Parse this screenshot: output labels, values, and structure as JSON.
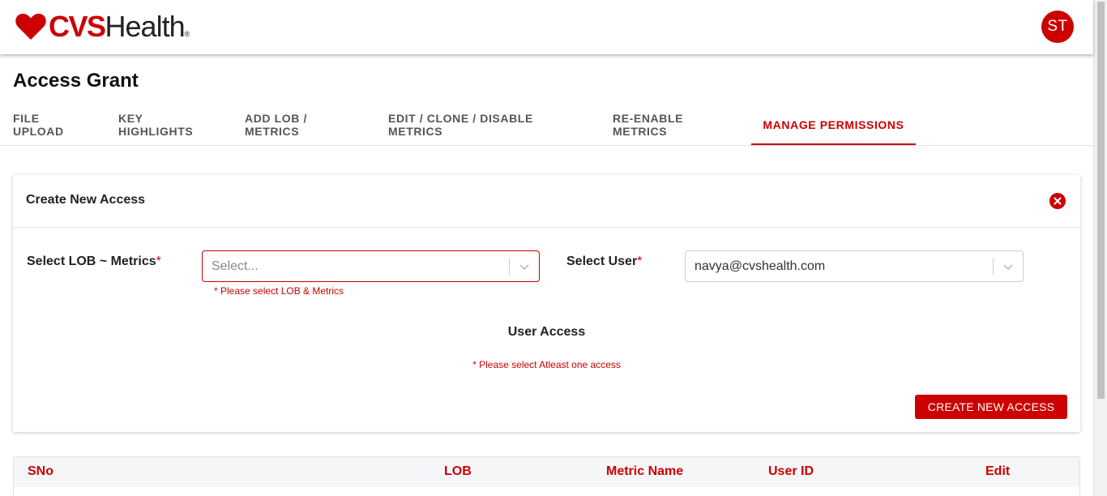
{
  "header": {
    "logo_brand": "CVS",
    "logo_suffix": "Health",
    "logo_reg": "®",
    "avatar_initials": "ST"
  },
  "page": {
    "title": "Access Grant"
  },
  "tabs": [
    {
      "label": "FILE UPLOAD",
      "active": false
    },
    {
      "label": "KEY HIGHLIGHTS",
      "active": false
    },
    {
      "label": "ADD LOB / METRICS",
      "active": false
    },
    {
      "label": "EDIT / CLONE / DISABLE METRICS",
      "active": false
    },
    {
      "label": "RE-ENABLE METRICS",
      "active": false
    },
    {
      "label": "MANAGE PERMISSIONS",
      "active": true
    }
  ],
  "card": {
    "title": "Create New Access",
    "lob_label": "Select LOB ~ Metrics",
    "required_mark": "*",
    "lob_placeholder": "Select...",
    "lob_error": "* Please select LOB & Metrics",
    "user_label": "Select User",
    "user_value": "navya@cvshealth.com",
    "user_access_title": "User Access",
    "access_error": "* Please select Atleast one access",
    "create_button": "CREATE NEW ACCESS"
  },
  "table": {
    "columns": [
      "SNo",
      "LOB",
      "Metric Name",
      "User ID",
      "Edit"
    ]
  },
  "colors": {
    "brand": "#cc0000",
    "text": "#222222",
    "tab_inactive": "#555555"
  },
  "icons": {
    "logo": "heart-icon",
    "close": "close-circle-icon",
    "dropdown": "chevron-down-icon"
  }
}
